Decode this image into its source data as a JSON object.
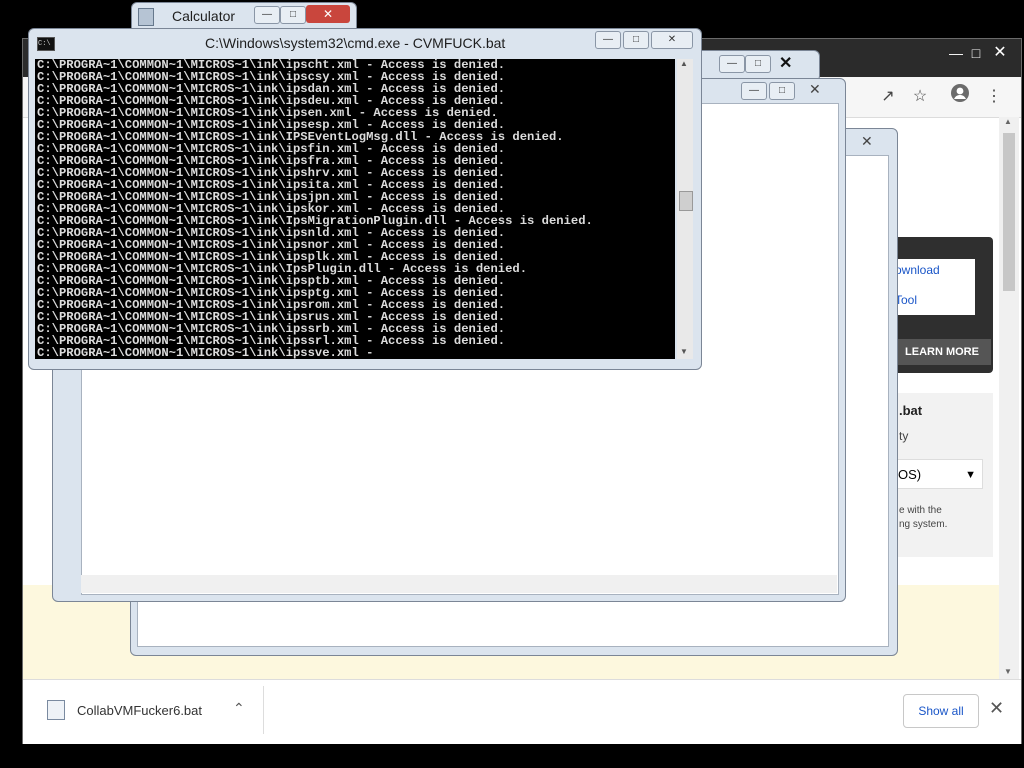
{
  "chrome": {
    "promo_link1": "ownload",
    "promo_link2": "Tool",
    "learn_more": "LEARN MORE",
    "panel_title": ".bat",
    "panel_sub": "ty",
    "panel_select": "OS)",
    "panel_note1": "e with the",
    "panel_note2": "ng system.",
    "download_file": "CollabVMFucker6.bat",
    "show_all": "Show all"
  },
  "calculator": {
    "title": "Calculator"
  },
  "cmd": {
    "title": "C:\\Windows\\system32\\cmd.exe - CVMFUCK.bat",
    "lines": [
      "C:\\PROGRA~1\\COMMON~1\\MICROS~1\\ink\\ipscht.xml - Access is denied.",
      "C:\\PROGRA~1\\COMMON~1\\MICROS~1\\ink\\ipscsy.xml - Access is denied.",
      "C:\\PROGRA~1\\COMMON~1\\MICROS~1\\ink\\ipsdan.xml - Access is denied.",
      "C:\\PROGRA~1\\COMMON~1\\MICROS~1\\ink\\ipsdeu.xml - Access is denied.",
      "C:\\PROGRA~1\\COMMON~1\\MICROS~1\\ink\\ipsen.xml - Access is denied.",
      "C:\\PROGRA~1\\COMMON~1\\MICROS~1\\ink\\ipsesp.xml - Access is denied.",
      "C:\\PROGRA~1\\COMMON~1\\MICROS~1\\ink\\IPSEventLogMsg.dll - Access is denied.",
      "C:\\PROGRA~1\\COMMON~1\\MICROS~1\\ink\\ipsfin.xml - Access is denied.",
      "C:\\PROGRA~1\\COMMON~1\\MICROS~1\\ink\\ipsfra.xml - Access is denied.",
      "C:\\PROGRA~1\\COMMON~1\\MICROS~1\\ink\\ipshrv.xml - Access is denied.",
      "C:\\PROGRA~1\\COMMON~1\\MICROS~1\\ink\\ipsita.xml - Access is denied.",
      "C:\\PROGRA~1\\COMMON~1\\MICROS~1\\ink\\ipsjpn.xml - Access is denied.",
      "C:\\PROGRA~1\\COMMON~1\\MICROS~1\\ink\\ipskor.xml - Access is denied.",
      "C:\\PROGRA~1\\COMMON~1\\MICROS~1\\ink\\IpsMigrationPlugin.dll - Access is denied.",
      "C:\\PROGRA~1\\COMMON~1\\MICROS~1\\ink\\ipsnld.xml - Access is denied.",
      "C:\\PROGRA~1\\COMMON~1\\MICROS~1\\ink\\ipsnor.xml - Access is denied.",
      "C:\\PROGRA~1\\COMMON~1\\MICROS~1\\ink\\ipsplk.xml - Access is denied.",
      "C:\\PROGRA~1\\COMMON~1\\MICROS~1\\ink\\IpsPlugin.dll - Access is denied.",
      "C:\\PROGRA~1\\COMMON~1\\MICROS~1\\ink\\ipsptb.xml - Access is denied.",
      "C:\\PROGRA~1\\COMMON~1\\MICROS~1\\ink\\ipsptg.xml - Access is denied.",
      "C:\\PROGRA~1\\COMMON~1\\MICROS~1\\ink\\ipsrom.xml - Access is denied.",
      "C:\\PROGRA~1\\COMMON~1\\MICROS~1\\ink\\ipsrus.xml - Access is denied.",
      "C:\\PROGRA~1\\COMMON~1\\MICROS~1\\ink\\ipssrb.xml - Access is denied.",
      "C:\\PROGRA~1\\COMMON~1\\MICROS~1\\ink\\ipssrl.xml - Access is denied.",
      "C:\\PROGRA~1\\COMMON~1\\MICROS~1\\ink\\ipssve.xml -"
    ]
  },
  "icons": {
    "minimize": "minimize-icon",
    "maximize": "maximize-icon",
    "close": "close-icon",
    "share": "share-icon",
    "bookmark": "star-icon",
    "profile": "profile-icon",
    "menu": "kebab-menu-icon",
    "file": "file-icon",
    "chevron": "chevron-up-icon"
  }
}
